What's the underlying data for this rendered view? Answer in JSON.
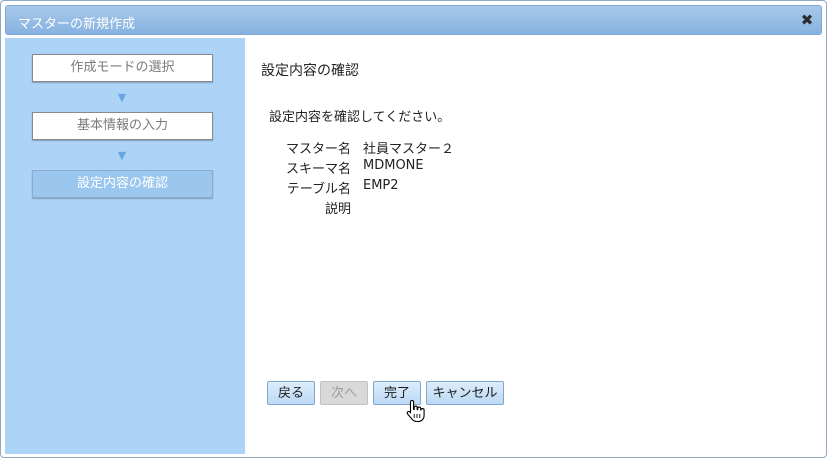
{
  "dialog": {
    "title": "マスターの新規作成",
    "close_glyph": "✖"
  },
  "steps": [
    {
      "label": "作成モードの選択",
      "active": false
    },
    {
      "label": "基本情報の入力",
      "active": false
    },
    {
      "label": "設定内容の確認",
      "active": true
    }
  ],
  "step_arrow": "▼",
  "content": {
    "section_title": "設定内容の確認",
    "instruction": "設定内容を確認してください。",
    "fields": [
      {
        "label": "マスター名",
        "value": "社員マスター２"
      },
      {
        "label": "スキーマ名",
        "value": "MDMONE"
      },
      {
        "label": "テーブル名",
        "value": "EMP2"
      },
      {
        "label": "説明",
        "value": ""
      }
    ]
  },
  "buttons": {
    "back": "戻る",
    "next": "次へ",
    "finish": "完了",
    "cancel": "キャンセル"
  },
  "colors": {
    "sidebar_bg": "#add3f6",
    "title_bar": "#86b2e0",
    "active_step": "#9bc7ef"
  },
  "icons": {
    "close": "close-icon",
    "step_arrow": "triangle-down-icon",
    "cursor": "hand-pointer-icon"
  }
}
